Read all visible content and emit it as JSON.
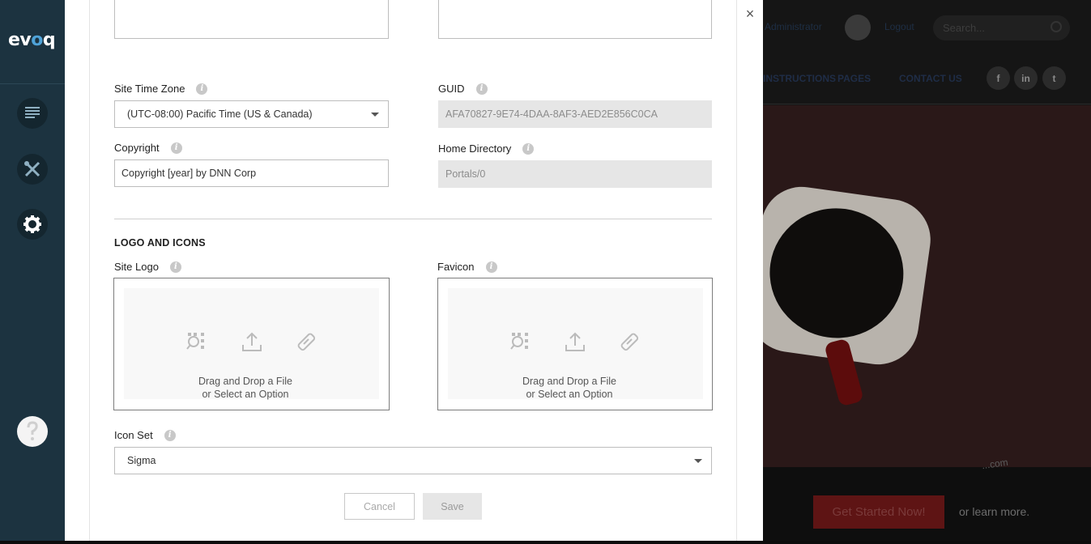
{
  "persona_bar": {
    "logo": {
      "prefix": "ev",
      "accent": "o",
      "suffix": "q"
    },
    "icons": [
      "content-icon",
      "tools-icon",
      "settings-icon",
      "help-icon"
    ]
  },
  "background_site": {
    "user_name": "Administrator",
    "login_link": "Logout",
    "search_placeholder": "Search...",
    "nav": [
      "INSTRUCTIONS",
      "PAGES",
      "CONTACT US"
    ],
    "social": [
      "f",
      "in",
      "t"
    ],
    "cta_label": "Get Started Now!",
    "learn_more": "or learn more.",
    "script_text": "...com"
  },
  "dialog": {
    "close_symbol": "×",
    "site_time_zone": {
      "label": "Site Time Zone",
      "value": "(UTC-08:00) Pacific Time (US & Canada)"
    },
    "guid": {
      "label": "GUID",
      "value": "AFA70827-9E74-4DAA-8AF3-AED2E856C0CA"
    },
    "copyright": {
      "label": "Copyright",
      "value": "Copyright [year] by DNN Corp"
    },
    "home_directory": {
      "label": "Home Directory",
      "value": "Portals/0"
    },
    "logo_section_title": "LOGO AND ICONS",
    "site_logo": {
      "label": "Site Logo",
      "drop_line1": "Drag and Drop a File",
      "drop_line2": "or Select an Option"
    },
    "favicon": {
      "label": "Favicon",
      "drop_line1": "Drag and Drop a File",
      "drop_line2": "or Select an Option"
    },
    "icon_set": {
      "label": "Icon Set",
      "value": "Sigma"
    },
    "buttons": {
      "cancel": "Cancel",
      "save": "Save"
    }
  },
  "colors": {
    "persona_bg": "#1c3340",
    "accent": "#4fa3d8",
    "dialog_bg": "#ffffff",
    "disabled_field": "#e6e6e6"
  }
}
